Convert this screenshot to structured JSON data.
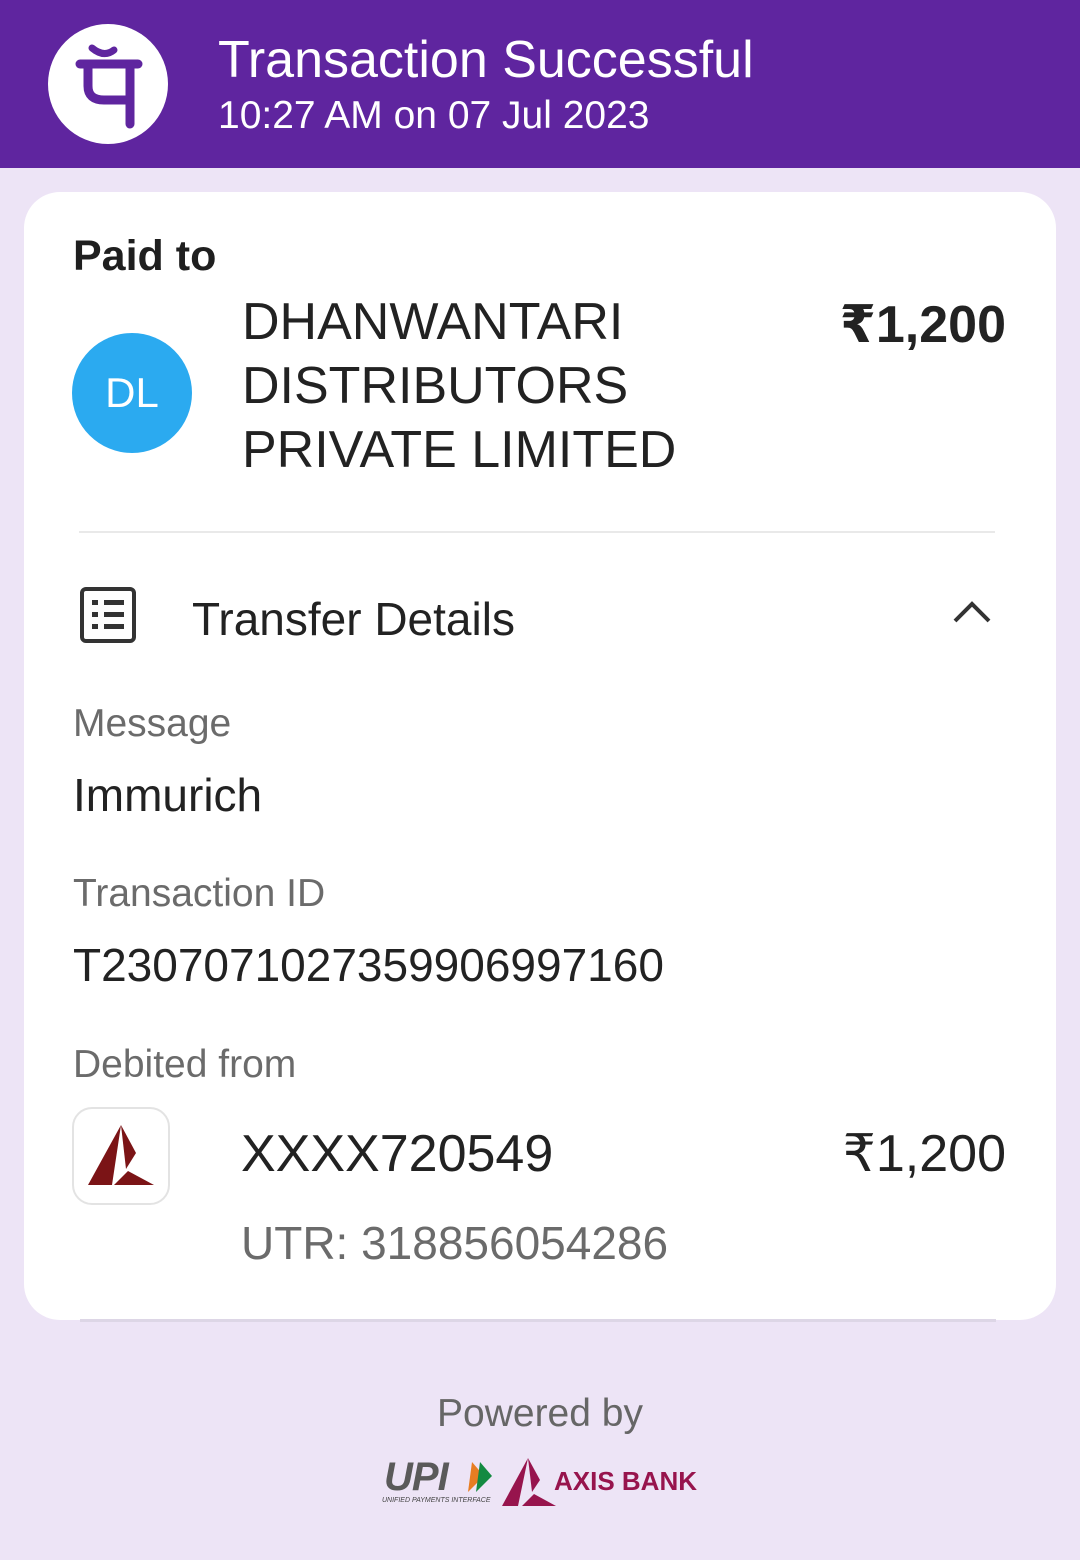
{
  "header": {
    "status": "Transaction Successful",
    "timestamp": "10:27 AM on 07 Jul 2023",
    "brand_color": "#5f259f"
  },
  "payment": {
    "paid_to_label": "Paid to",
    "avatar_initials": "DL",
    "avatar_color": "#2baaf0",
    "payee_lines": [
      "DHANWANTARI",
      "DISTRIBUTORS",
      "PRIVATE LIMITED"
    ],
    "amount": "₹1,200"
  },
  "transfer_details": {
    "title": "Transfer Details",
    "icon": "list-icon",
    "expanded": true,
    "message_label": "Message",
    "message_value": "Immurich",
    "txn_id_label": "Transaction ID",
    "txn_id_value": "T2307071027359906997160",
    "debited_label": "Debited from",
    "account": "XXXX720549",
    "debited_amount": "₹1,200",
    "utr": "UTR: 318856054286"
  },
  "footer": {
    "powered_by": "Powered by",
    "upi_text": "UPI",
    "upi_subtext": "UNIFIED PAYMENTS INTERFACE",
    "bank_name": "AXIS BANK",
    "bank_color": "#97144d"
  }
}
